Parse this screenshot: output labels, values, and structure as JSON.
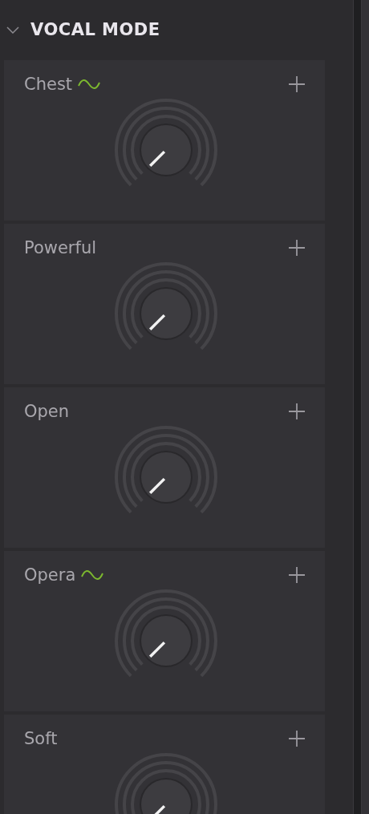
{
  "section": {
    "title": "VOCAL MODE",
    "expanded": true
  },
  "modes": [
    {
      "name": "Chest",
      "modulated": true
    },
    {
      "name": "Powerful",
      "modulated": false
    },
    {
      "name": "Open",
      "modulated": false
    },
    {
      "name": "Opera",
      "modulated": true
    },
    {
      "name": "Soft",
      "modulated": false
    }
  ]
}
